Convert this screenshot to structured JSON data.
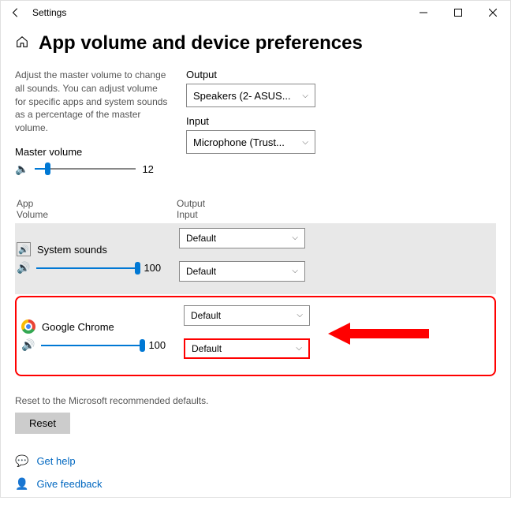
{
  "window": {
    "title": "Settings"
  },
  "page": {
    "heading": "App volume and device preferences",
    "description": "Adjust the master volume to change all sounds. You can adjust volume for specific apps and system sounds as a percentage of the master volume.",
    "master_label": "Master volume",
    "master_value": "12"
  },
  "output": {
    "label": "Output",
    "value": "Speakers (2- ASUS..."
  },
  "input": {
    "label": "Input",
    "value": "Microphone (Trust..."
  },
  "table": {
    "col1a": "App",
    "col1b": "Volume",
    "col2a": "Output",
    "col2b": "Input"
  },
  "apps": {
    "sys": {
      "name": "System sounds",
      "vol": "100",
      "out": "Default",
      "in": "Default"
    },
    "chrome": {
      "name": "Google Chrome",
      "vol": "100",
      "out": "Default",
      "in": "Default"
    }
  },
  "reset": {
    "label": "Reset to the Microsoft recommended defaults.",
    "button": "Reset"
  },
  "links": {
    "help": "Get help",
    "feedback": "Give feedback"
  }
}
